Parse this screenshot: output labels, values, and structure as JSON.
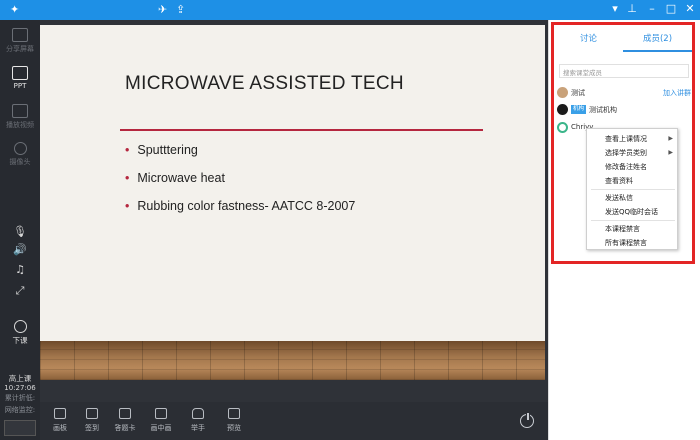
{
  "window": {
    "pin_icon": "pin-icon",
    "minimize_icon": "minimize-icon",
    "maximize_icon": "maximize-icon",
    "close_icon": "close-icon"
  },
  "sidebar": {
    "items": [
      {
        "label": "分享屏幕",
        "icon": "share-screen-icon"
      },
      {
        "label": "PPT",
        "icon": "ppt-icon"
      },
      {
        "label": "播放视频",
        "icon": "play-video-icon"
      },
      {
        "label": "摄像头",
        "icon": "camera-icon"
      }
    ],
    "end_class_label": "下课",
    "status_title": "高上课",
    "status_time": "10:27:06",
    "status_line1": "累计折低:",
    "status_line2": "网络监控:"
  },
  "slide": {
    "title": "MICROWAVE ASSISTED TECH",
    "bullets": [
      "Sputttering",
      "Microwave heat",
      "Rubbing color fastness- AATCC 8-2007"
    ],
    "accent_color": "#b5273f"
  },
  "toolbar": {
    "items": [
      "画板",
      "签到",
      "答题卡",
      "画中画",
      "举手",
      "预览"
    ]
  },
  "right_panel": {
    "tabs": [
      {
        "label": "讨论",
        "active": false
      },
      {
        "label": "成员(2)",
        "active": true
      }
    ],
    "search_placeholder": "搜索课堂成员",
    "members": [
      {
        "name": "测试",
        "action": "加入讲群"
      },
      {
        "name": "测试机构",
        "badge": "机构"
      },
      {
        "name": "Chriyy"
      }
    ]
  },
  "context_menu": {
    "items": [
      {
        "label": "查看上课情况",
        "submenu": true
      },
      {
        "label": "选择学员类别",
        "submenu": true
      },
      {
        "label": "修改备注姓名",
        "submenu": false
      },
      {
        "label": "查看资料",
        "submenu": false
      },
      {
        "label": "发送私信",
        "submenu": false
      },
      {
        "label": "发送QQ临时会话",
        "submenu": false
      },
      {
        "label": "本课程禁言",
        "submenu": false
      },
      {
        "label": "所有课程禁言",
        "submenu": false
      }
    ]
  },
  "colors": {
    "titlebar": "#1e90e6",
    "highlight_frame": "#e32525",
    "tab_active": "#2f8fe0"
  }
}
